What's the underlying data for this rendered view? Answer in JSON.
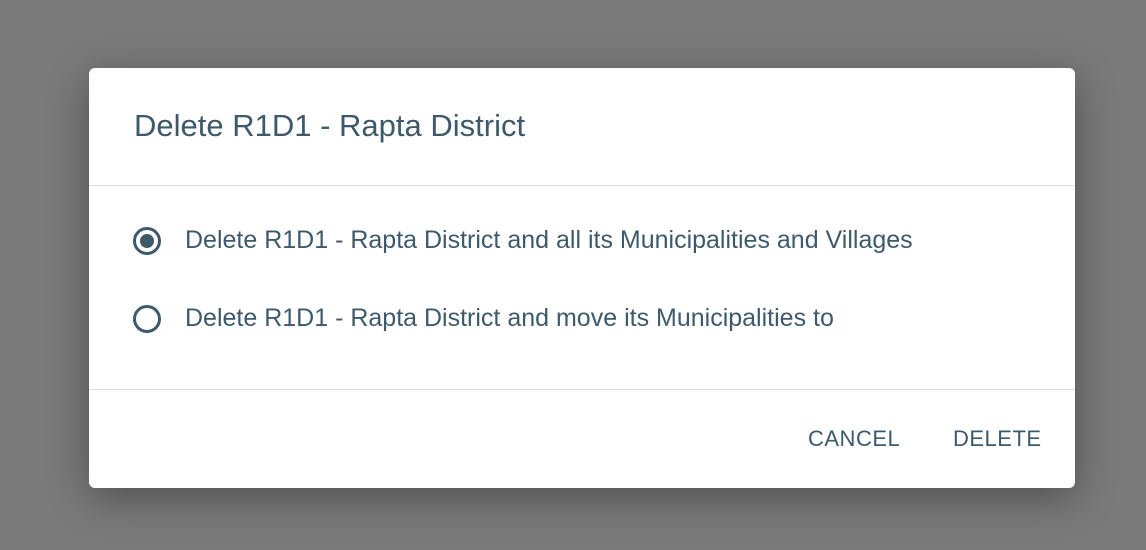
{
  "dialog": {
    "title": "Delete R1D1 - Rapta District",
    "options": [
      {
        "label": "Delete R1D1 - Rapta District and all its Municipalities and Villages",
        "selected": true
      },
      {
        "label": "Delete R1D1 - Rapta District and move its Municipalities to",
        "selected": false
      }
    ],
    "cancel_label": "CANCEL",
    "delete_label": "DELETE"
  }
}
